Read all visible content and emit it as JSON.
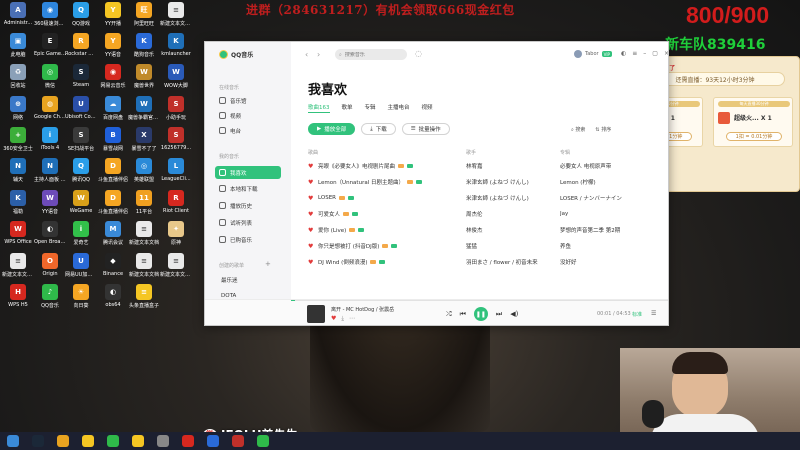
{
  "overlay": {
    "promo": "进群（284631217）有机会领取666现金红包",
    "score": "800/900",
    "team": "新车队839416",
    "watermark": "JEOLH姜先生",
    "live_title": "1月 五天了",
    "live_sub": "还需直播：93天12小时3分钟",
    "cards": [
      {
        "top": "每天直播60分钟",
        "name": "圆月卡 X 1",
        "price": "1扣 = 0.01分钟"
      },
      {
        "top": "每天直播30分钟",
        "name": "超级火... X 1",
        "price": "1扣 = 0.01分钟"
      }
    ]
  },
  "desktop_icons": [
    {
      "label": "Administr...",
      "color": "#4a6fb5",
      "glyph": "A"
    },
    {
      "label": "此电脑",
      "color": "#3a8ad8",
      "glyph": "▣"
    },
    {
      "label": "回收站",
      "color": "#8aa0b8",
      "glyph": "♻"
    },
    {
      "label": "网络",
      "color": "#3a78c8",
      "glyph": "⊕"
    },
    {
      "label": "360安全卫士",
      "color": "#3cae3a",
      "glyph": "+"
    },
    {
      "label": "辅天",
      "color": "#1f6fb8",
      "glyph": "N"
    },
    {
      "label": "福勒",
      "color": "#2b5fa8",
      "glyph": "K"
    },
    {
      "label": "WPS Office",
      "color": "#d6281f",
      "glyph": "W"
    },
    {
      "label": "新建文本文档 (5)",
      "color": "#e9e9e9",
      "glyph": "≡"
    },
    {
      "label": "WPS H5",
      "color": "#d6281f",
      "glyph": "H"
    },
    {
      "label": "360极速浏览器",
      "color": "#2e86de",
      "glyph": "◉"
    },
    {
      "label": "Epic Games Launcher",
      "color": "#222222",
      "glyph": "E"
    },
    {
      "label": "微信",
      "color": "#2fb94a",
      "glyph": "◎"
    },
    {
      "label": "Google Chrome",
      "color": "#e8a320",
      "glyph": "◍"
    },
    {
      "label": "iTools 4",
      "color": "#2a9ee8",
      "glyph": "i"
    },
    {
      "label": "主持人面板 V2",
      "color": "#1f6fb8",
      "glyph": "N"
    },
    {
      "label": "YY语音",
      "color": "#6d4bb8",
      "glyph": "W"
    },
    {
      "label": "Open Broadcast...",
      "color": "#333333",
      "glyph": "◐"
    },
    {
      "label": "Origin",
      "color": "#f0672a",
      "glyph": "O"
    },
    {
      "label": "QQ音乐",
      "color": "#2fb94a",
      "glyph": "♪"
    },
    {
      "label": "QQ游戏",
      "color": "#2a9ee8",
      "glyph": "Q"
    },
    {
      "label": "Rockstar Games...",
      "color": "#f5a623",
      "glyph": "R"
    },
    {
      "label": "Steam",
      "color": "#1b2838",
      "glyph": "S"
    },
    {
      "label": "Ubisoft Connect",
      "color": "#2a4fa8",
      "glyph": "U"
    },
    {
      "label": "SE扫战平台",
      "color": "#3a3a3a",
      "glyph": "S"
    },
    {
      "label": "腾讯QQ",
      "color": "#2a9ee8",
      "glyph": "Q"
    },
    {
      "label": "WeGame",
      "color": "#d9a019",
      "glyph": "W"
    },
    {
      "label": "爱奇艺",
      "color": "#32c04a",
      "glyph": "i"
    },
    {
      "label": "网易UU加速器",
      "color": "#2a6ad8",
      "glyph": "U"
    },
    {
      "label": "向日葵",
      "color": "#f5a623",
      "glyph": "☀"
    },
    {
      "label": "YY开播",
      "color": "#f5c623",
      "glyph": "Y"
    },
    {
      "label": "YY语音",
      "color": "#f5a623",
      "glyph": "Y"
    },
    {
      "label": "网易云音乐",
      "color": "#d6281f",
      "glyph": "◉"
    },
    {
      "label": "百度网盘",
      "color": "#3a8ad8",
      "glyph": "☁"
    },
    {
      "label": "暴雪战网",
      "color": "#1f5fd8",
      "glyph": "B"
    },
    {
      "label": "斗鱼直播伴侣",
      "color": "#f5a623",
      "glyph": "D"
    },
    {
      "label": "斗鱼直播伴侣",
      "color": "#f5a623",
      "glyph": "D"
    },
    {
      "label": "腾讯会议",
      "color": "#3a8ad8",
      "glyph": "M"
    },
    {
      "label": "Binance",
      "color": "#222222",
      "glyph": "◆"
    },
    {
      "label": "obs64",
      "color": "#333333",
      "glyph": "◐"
    },
    {
      "label": "阿里旺旺",
      "color": "#f5a623",
      "glyph": "旺"
    },
    {
      "label": "酷狗音乐",
      "color": "#2a6ad8",
      "glyph": "K"
    },
    {
      "label": "魔兽世界",
      "color": "#c08a2a",
      "glyph": "W"
    },
    {
      "label": "魔兽争霸官方对战平台",
      "color": "#1f6fb8",
      "glyph": "W"
    },
    {
      "label": "暴雪不了了",
      "color": "#2a3a6a",
      "glyph": "X"
    },
    {
      "label": "英雄联盟",
      "color": "#2a8ad8",
      "glyph": "◎"
    },
    {
      "label": "11平台",
      "color": "#f0a020",
      "glyph": "11"
    },
    {
      "label": "新建文本文档",
      "color": "#e9e9e9",
      "glyph": "≡"
    },
    {
      "label": "新建文本文档",
      "color": "#e9e9e9",
      "glyph": "≡"
    },
    {
      "label": "头条直播盒子",
      "color": "#f5c623",
      "glyph": "≡"
    },
    {
      "label": "新建文本文档 (3)",
      "color": "#e9e9e9",
      "glyph": "≡"
    },
    {
      "label": "kmlauncher",
      "color": "#1f6fb8",
      "glyph": "K"
    },
    {
      "label": "WOW大脚",
      "color": "#2a5ab8",
      "glyph": "W"
    },
    {
      "label": "小助手玩",
      "color": "#c0302a",
      "glyph": "S"
    },
    {
      "label": "16256779...",
      "color": "#c0302a",
      "glyph": "S"
    },
    {
      "label": "LeagueCli...",
      "color": "#2a8ad8",
      "glyph": "L"
    },
    {
      "label": "Riot Client",
      "color": "#d6281f",
      "glyph": "R"
    },
    {
      "label": "原神",
      "color": "#e8c88a",
      "glyph": "✦"
    },
    {
      "label": "新建文本文档 (6)",
      "color": "#e9e9e9",
      "glyph": "≡"
    }
  ],
  "qqmusic": {
    "app_name": "QQ音乐",
    "search_placeholder": "搜索音乐",
    "username": "Tabor",
    "vip_label": "VIP",
    "sidebar": {
      "section_online": "在线音乐",
      "online_items": [
        "音乐馆",
        "视频",
        "电台"
      ],
      "section_mine": "我的音乐",
      "mine_items": [
        "我喜欢",
        "本地和下载",
        "播放历史",
        "试听列表",
        "已购音乐"
      ],
      "section_created": "创建的歌单",
      "created_items": [
        "最乐迷",
        "DOTA",
        "listen"
      ]
    },
    "page_title": "我喜欢",
    "tabs": [
      "歌曲163",
      "歌单",
      "专辑",
      "主播电台",
      "视频"
    ],
    "actions": {
      "play_all": "播放全部",
      "download": "下载",
      "batch": "批量操作"
    },
    "tools": {
      "search": "搜索",
      "sort": "排序"
    },
    "columns": {
      "title": "歌曲",
      "artist": "歌手",
      "album": "专辑"
    },
    "songs": [
      {
        "title": "亮眼《必要女人》电视剧片尾曲",
        "artist": "林宥嘉",
        "album": "必要女人 电视原声带"
      },
      {
        "title": "Lemon（Unnatural 日剧主题曲）",
        "artist": "米津玄師 (よねづ けんし)",
        "album": "Lemon (柠檬)"
      },
      {
        "title": "LOSER",
        "artist": "米津玄師 (よねづ けんし)",
        "album": "LOSER / ナンバーナイン"
      },
      {
        "title": "可爱女人",
        "artist": "周杰伦",
        "album": "Jay"
      },
      {
        "title": "爱你 (Live)",
        "artist": "林俊杰",
        "album": "梦想的声音第二季 第2期"
      },
      {
        "title": "你只是想被打 (抖音DJ版)",
        "artist": "猛猛",
        "album": "养鱼"
      },
      {
        "title": "DJ Wind (倒频浪漫)",
        "artist": "羽田まさ / flower / 初音未来",
        "album": "没好好"
      }
    ],
    "player": {
      "now_playing": "离开 - MC HotDog / 张震岳",
      "time": "00:01 / 04:53",
      "quality": "标准",
      "progress": 0.01
    }
  },
  "taskbar": {
    "icons": [
      "windows-start",
      "steam",
      "chrome",
      "folder",
      "qq-music",
      "file-explorer",
      "settings",
      "netease",
      "kugou",
      "game",
      "yy"
    ]
  }
}
